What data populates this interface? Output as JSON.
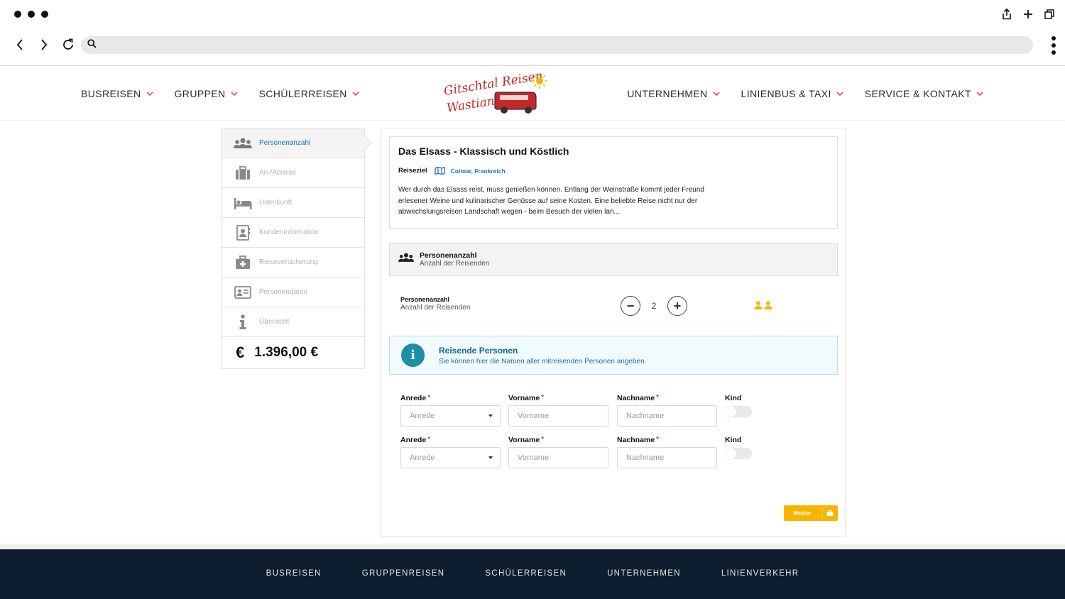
{
  "browser": {
    "url": "",
    "icons": [
      "share-icon",
      "new-tab-icon",
      "tabs-icon",
      "back-icon",
      "forward-icon",
      "reload-icon",
      "search-icon",
      "more-icon"
    ]
  },
  "header": {
    "logo_alt": "Gitschtal Reisen Wastian",
    "logo_line1": "Gitschtal Reisen",
    "logo_line2": "Wastian",
    "menu_left": [
      "BUSREISEN",
      "GRUPPEN",
      "SCHÜLERREISEN"
    ],
    "menu_right": [
      "UNTERNEHMEN",
      "LINIENBUS & TAXI",
      "SERVICE & KONTAKT"
    ],
    "accent_color": "#e53935"
  },
  "sidebar": {
    "steps": [
      {
        "label": "Personenanzahl",
        "icon": "group-icon",
        "active": true
      },
      {
        "label": "An-/Abreise",
        "icon": "suitcase-icon",
        "active": false
      },
      {
        "label": "Unterkunft",
        "icon": "bed-icon",
        "active": false
      },
      {
        "label": "Kundeninformation",
        "icon": "contact-book-icon",
        "active": false
      },
      {
        "label": "Reiseversicherung",
        "icon": "medical-kit-icon",
        "active": false
      },
      {
        "label": "Personendaten",
        "icon": "id-card-icon",
        "active": false
      },
      {
        "label": "Übersicht",
        "icon": "info-icon",
        "active": false
      }
    ],
    "price_symbol": "€",
    "price": "1.396,00 €"
  },
  "trip": {
    "title": "Das Elsass - Klassisch und Köstlich",
    "destination_label": "Reiseziel",
    "destination": "Colmar, Frankreich",
    "description": "Wer durch das Elsass reist, muss genießen können. Entlang der Weinstraße kommt jeder Freund erlesener Weine und kulinarischer Genüsse auf seine Kosten. Eine beliebte Reise nicht nur der abwechslungsreisen Landschaft wegen - beim Besuch der vielen lan..."
  },
  "section": {
    "title": "Personenanzahl",
    "subtitle": "Anzahl der Reisenden"
  },
  "counter": {
    "label": "Personenanzahl",
    "sublabel": "Anzahl der Reisenden",
    "value": "2",
    "minus": "−",
    "plus": "+",
    "person_icon_color": "#f7b500"
  },
  "info": {
    "icon": "i",
    "title": "Reisende Personen",
    "text": "Sie können hier die Namen aller mitreisenden Personen angeben."
  },
  "form": {
    "rows": [
      {
        "anrede_label": "Anrede",
        "anrede_placeholder": "Anrede",
        "vorname_label": "Vorname",
        "vorname_placeholder": "Vorname",
        "nachname_label": "Nachname",
        "nachname_placeholder": "Nachname",
        "kind_label": "Kind"
      },
      {
        "anrede_label": "Anrede",
        "anrede_placeholder": "Anrede",
        "vorname_label": "Vorname",
        "vorname_placeholder": "Vorname",
        "nachname_label": "Nachname",
        "nachname_placeholder": "Nachname",
        "kind_label": "Kind"
      }
    ],
    "required_mark": "*",
    "next_button": "Weiter",
    "next_button_color": "#f7b500"
  },
  "footer": {
    "links": [
      "BUSREISEN",
      "GRUPPENREISEN",
      "SCHÜLERREISEN",
      "UNTERNEHMEN",
      "LINIENVERKEHR"
    ],
    "background": "#0d1c2e"
  }
}
